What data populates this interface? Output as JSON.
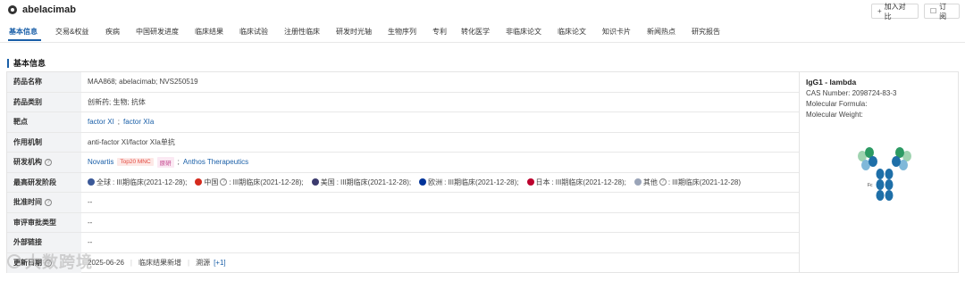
{
  "header": {
    "title": "abelacimab",
    "compare_label": "加入对比",
    "subscribe_label": "订阅"
  },
  "tabs": [
    "基本信息",
    "交易&权益",
    "疾病",
    "中国研发进度",
    "临床结果",
    "临床试验",
    "注册性临床",
    "研发时光轴",
    "生物序列",
    "专利",
    "转化医学",
    "非临床论文",
    "临床论文",
    "知识卡片",
    "新闻热点",
    "研究报告"
  ],
  "section_title": "基本信息",
  "info": {
    "name_label": "药品名称",
    "name_value": "MAA868; abelacimab; NVS250519",
    "type_label": "药品类别",
    "type_value": "创新药; 生物; 抗体",
    "target_label": "靶点",
    "target_1": "factor XI",
    "target_sep": ";",
    "target_2": "factor XIa",
    "mech_label": "作用机制",
    "mech_value": "anti-factor XI/factor XIa单抗",
    "org_label": "研发机构",
    "org_1": "Novartis",
    "org_tag": "Top20 MNC",
    "org_tag2": "原研",
    "org_sep": ";",
    "org_2": "Anthos Therapeutics",
    "phase_label": "最高研发阶段",
    "phases": [
      {
        "region": "全球",
        "text": "III期临床(2021-12-28);",
        "color": "#3b5998"
      },
      {
        "region": "中国",
        "text": "III期临床(2021-12-28);",
        "color": "#d52b1e"
      },
      {
        "region": "美国",
        "text": "III期临床(2021-12-28);",
        "color": "#3c3b6e"
      },
      {
        "region": "欧洲",
        "text": "III期临床(2021-12-28);",
        "color": "#003399"
      },
      {
        "region": "日本",
        "text": "III期临床(2021-12-28);",
        "color": "#bc002d"
      },
      {
        "region": "其他",
        "text": "III期临床(2021-12-28)",
        "color": "#9aa4b8"
      }
    ],
    "approval_time_label": "批准时间",
    "approval_time_value": "--",
    "review_type_label": "审评审批类型",
    "review_type_value": "--",
    "external_link_label": "外部链接",
    "external_link_value": "--",
    "update_label": "更新日期",
    "update_value": "2025-06-26",
    "update_item": "临床结果新增",
    "update_trace": "溯源",
    "update_more": "[+1]"
  },
  "right_panel": {
    "title": "IgG1 - lambda",
    "cas": "CAS Number: 2098724-83-3",
    "formula": "Molecular Formula:",
    "weight": "Molecular Weight:",
    "fc_label": "Fc"
  },
  "watermark": "大数跨境"
}
